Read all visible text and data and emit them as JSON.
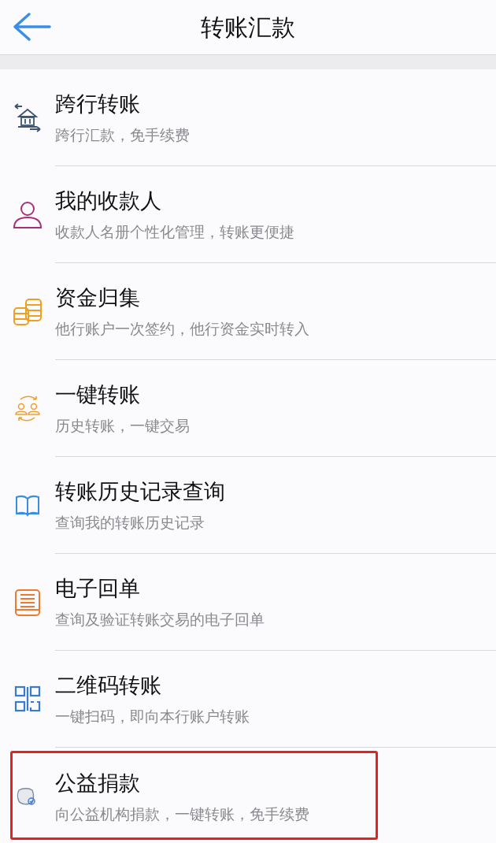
{
  "header": {
    "title": "转账汇款"
  },
  "items": [
    {
      "kind": "bank",
      "title": "跨行转账",
      "subtitle": "跨行汇款，免手续费",
      "highlighted": false
    },
    {
      "kind": "person",
      "title": "我的收款人",
      "subtitle": "收款人名册个性化管理，转账更便捷",
      "highlighted": false
    },
    {
      "kind": "coins",
      "title": "资金归集",
      "subtitle": "他行账户一次签约，他行资金实时转入",
      "highlighted": false
    },
    {
      "kind": "exchange",
      "title": "一键转账",
      "subtitle": "历史转账，一键交易",
      "highlighted": false
    },
    {
      "kind": "book",
      "title": "转账历史记录查询",
      "subtitle": "查询我的转账历史记录",
      "highlighted": false
    },
    {
      "kind": "receipt",
      "title": "电子回单",
      "subtitle": "查询及验证转账交易的电子回单",
      "highlighted": false
    },
    {
      "kind": "qr",
      "title": "二维码转账",
      "subtitle": "一键扫码，即向本行账户转账",
      "highlighted": false
    },
    {
      "kind": "donate",
      "title": "公益捐款",
      "subtitle": "向公益机构捐款，一键转账，免手续费",
      "highlighted": true
    }
  ]
}
